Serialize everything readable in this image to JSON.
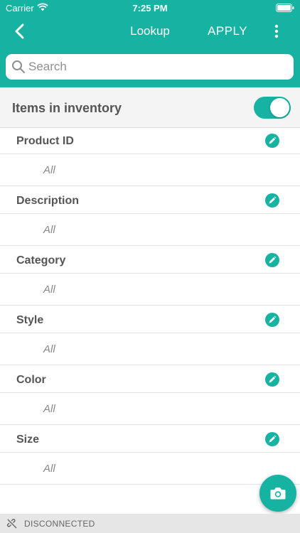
{
  "status_bar": {
    "carrier": "Carrier",
    "time": "7:25 PM"
  },
  "nav": {
    "title": "Lookup",
    "apply_label": "APPLY",
    "back_icon": "chevron-left-icon",
    "more_icon": "more-vertical-icon"
  },
  "search": {
    "placeholder": "Search",
    "value": ""
  },
  "inventory_toggle": {
    "label": "Items in inventory",
    "on": true
  },
  "filters": [
    {
      "label": "Product ID",
      "value": "All"
    },
    {
      "label": "Description",
      "value": "All"
    },
    {
      "label": "Category",
      "value": "All"
    },
    {
      "label": "Style",
      "value": "All"
    },
    {
      "label": "Color",
      "value": "All"
    },
    {
      "label": "Size",
      "value": "All"
    }
  ],
  "footer": {
    "status": "DISCONNECTED"
  },
  "colors": {
    "accent": "#16b3a2",
    "row_bg": "#f4f4f4",
    "text": "#555555"
  }
}
